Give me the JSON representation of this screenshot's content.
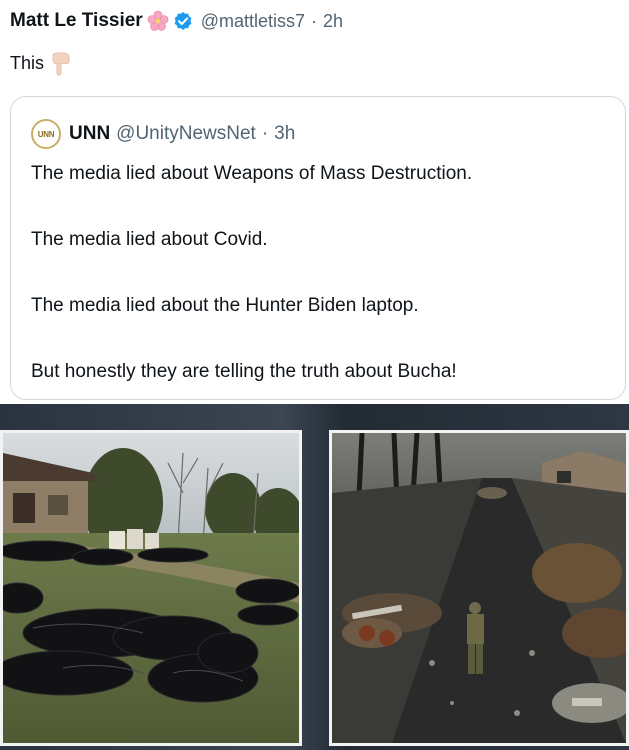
{
  "tweet": {
    "author_name": "Matt Le Tissier",
    "author_handle": "@mattletiss7",
    "separator": "·",
    "time": "2h",
    "text": "This",
    "icons": {
      "badge": "cherry-blossom-icon",
      "verified": "verified-badge-icon",
      "emoji": "pointing-down-hand-icon"
    },
    "colors": {
      "verified": "#1d9bf0",
      "handle": "#536471"
    }
  },
  "quoted_tweet": {
    "author_name": "UNN",
    "author_handle": "@UnityNewsNet",
    "separator": "·",
    "time": "3h",
    "logo_text": "UNN",
    "lines": [
      "The media lied about Weapons of Mass Destruction.",
      "The media lied about Covid.",
      "The media lied about the Hunter Biden laptop.",
      "But honestly they are telling the truth about Bucha!"
    ]
  },
  "media": {
    "images": [
      "photo-bodybags-yard",
      "photo-destroyed-street-soldier"
    ]
  }
}
